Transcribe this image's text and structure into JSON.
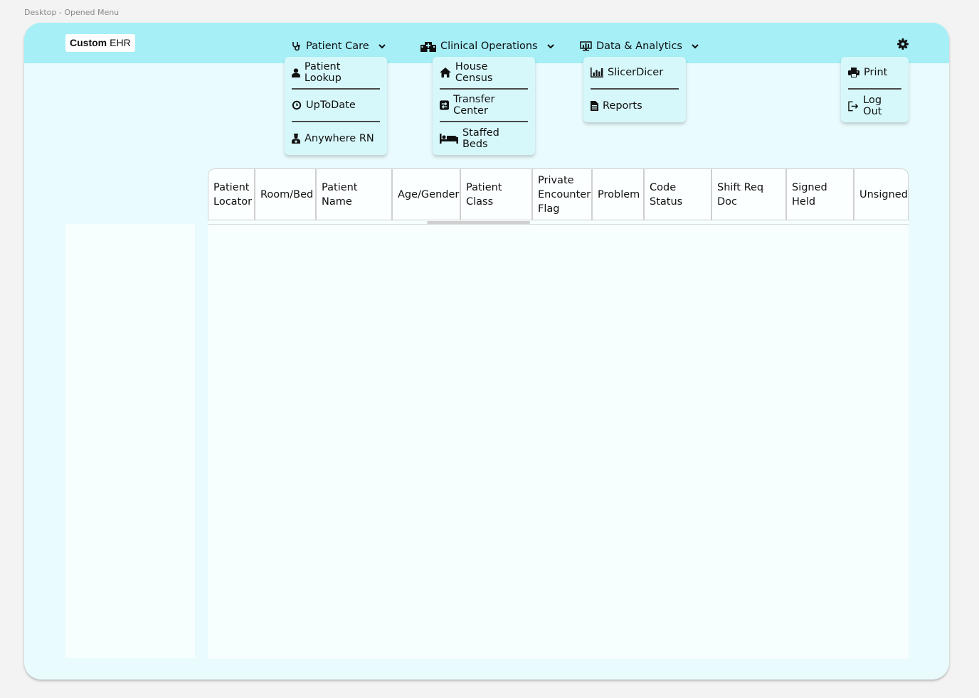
{
  "canvas_label": "Desktop - Opened Menu",
  "logo": {
    "bold": "Custom",
    "rest": "EHR"
  },
  "nav": {
    "patient_care": "Patient Care",
    "clinical_operations": "Clinical Operations",
    "data_analytics": "Data & Analytics"
  },
  "menus": {
    "patient_care": [
      "Patient Lookup",
      "UpToDate",
      "Anywhere RN"
    ],
    "clinical_operations": [
      "House Census",
      "Transfer Center",
      "Staffed Beds"
    ],
    "data_analytics": [
      "SlicerDicer",
      "Reports"
    ],
    "settings": [
      "Print",
      "Log Out"
    ]
  },
  "table": {
    "headers": [
      "Patient\nLocator",
      "Room/Bed",
      "Patient Name",
      "Age/Gender",
      "Patient Class",
      "Private\nEncounter\nFlag",
      "Problem",
      "Code Status",
      "Shift Req Doc",
      "Signed Held",
      "Unsigned Orders"
    ]
  },
  "colors": {
    "topbar": "#a6eff7",
    "frame": "#e9fbfd",
    "menu": "#d7f8fb"
  }
}
